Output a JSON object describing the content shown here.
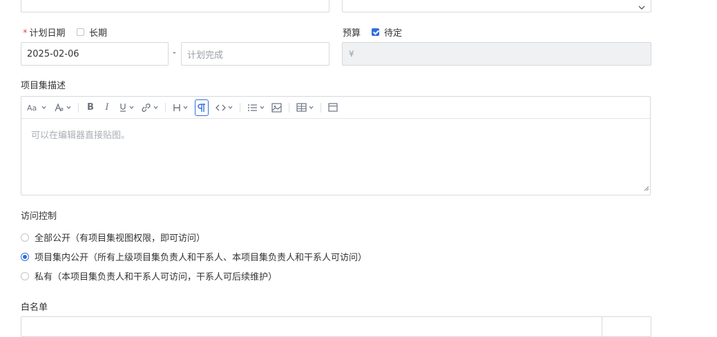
{
  "form": {
    "plan_date": {
      "label": "计划日期",
      "required_mark": "*",
      "long_term_label": "长期",
      "long_term_checked": false,
      "start_value": "2025-02-06",
      "range_separator": "-",
      "end_placeholder": "计划完成"
    },
    "budget": {
      "label": "预算",
      "pending_label": "待定",
      "pending_checked": true,
      "currency_symbol": "¥"
    },
    "description": {
      "label": "项目集描述",
      "editor_placeholder": "可以在编辑器直接贴图。",
      "toolbar": [
        "font-size-icon",
        "text-color-icon",
        "bold-icon",
        "italic-icon",
        "underline-icon",
        "link-icon",
        "heading-icon",
        "paragraph-icon",
        "code-icon",
        "list-icon",
        "image-icon",
        "table-icon",
        "fullscreen-icon"
      ]
    },
    "access": {
      "label": "访问控制",
      "options": [
        {
          "label": "全部公开（有项目集视图权限，即可访问）",
          "selected": false
        },
        {
          "label": "项目集内公开（所有上级项目集负责人和干系人、本项目集负责人和干系人可访问）",
          "selected": true
        },
        {
          "label": "私有（本项目集负责人和干系人可访问，干系人可后续维护）",
          "selected": false
        }
      ]
    },
    "whitelist": {
      "label": "白名单"
    }
  }
}
